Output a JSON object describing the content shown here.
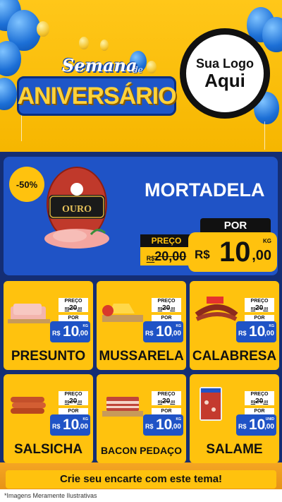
{
  "header": {
    "title_semana": "Semana",
    "title_de": "de",
    "title_main": "ANIVERSÁRIO",
    "logo_line1": "Sua Logo",
    "logo_line2": "Aqui"
  },
  "featured": {
    "discount": "-50%",
    "name": "MORTADELA",
    "image_text": "OURO",
    "preco_label": "PREÇO",
    "old_price_currency": "R$",
    "old_price": "20,00",
    "por_label": "POR",
    "new_price_currency": "R$",
    "new_price_int": "10",
    "new_price_cents": ",00",
    "unit": "KG"
  },
  "products": [
    {
      "name": "PRESUNTO",
      "preco_label": "PREÇO",
      "old_currency": "R$",
      "old_int": "20",
      "old_cents": ",00",
      "por_label": "POR",
      "currency": "R$",
      "int": "10",
      "cents": ",00",
      "unit": "KG"
    },
    {
      "name": "MUSSARELA",
      "preco_label": "PREÇO",
      "old_currency": "R$",
      "old_int": "20",
      "old_cents": ",00",
      "por_label": "POR",
      "currency": "R$",
      "int": "10",
      "cents": ",00",
      "unit": "KG"
    },
    {
      "name": "CALABRESA",
      "preco_label": "PREÇO",
      "old_currency": "R$",
      "old_int": "20",
      "old_cents": ",00",
      "por_label": "POR",
      "currency": "R$",
      "int": "10",
      "cents": ",00",
      "unit": "KG"
    },
    {
      "name": "SALSICHA",
      "preco_label": "PREÇO",
      "old_currency": "R$",
      "old_int": "20",
      "old_cents": ",00",
      "por_label": "POR",
      "currency": "R$",
      "int": "10",
      "cents": ",00",
      "unit": "KG"
    },
    {
      "name": "BACON PEDAÇO",
      "preco_label": "PREÇO",
      "old_currency": "R$",
      "old_int": "20",
      "old_cents": ",00",
      "por_label": "POR",
      "currency": "R$",
      "int": "10",
      "cents": ",00",
      "unit": "KG"
    },
    {
      "name": "SALAME",
      "preco_label": "PREÇO",
      "old_currency": "R$",
      "old_int": "20",
      "old_cents": ",00",
      "por_label": "POR",
      "currency": "R$",
      "int": "10",
      "cents": ",00",
      "unit": "UNID"
    }
  ],
  "cta": "Crie seu encarte com este tema!",
  "footer": "*Imagens Meramente Ilustrativas",
  "colors": {
    "yellow": "#ffc20e",
    "blue": "#1f53c6",
    "navy": "#142e74",
    "black": "#111111"
  }
}
